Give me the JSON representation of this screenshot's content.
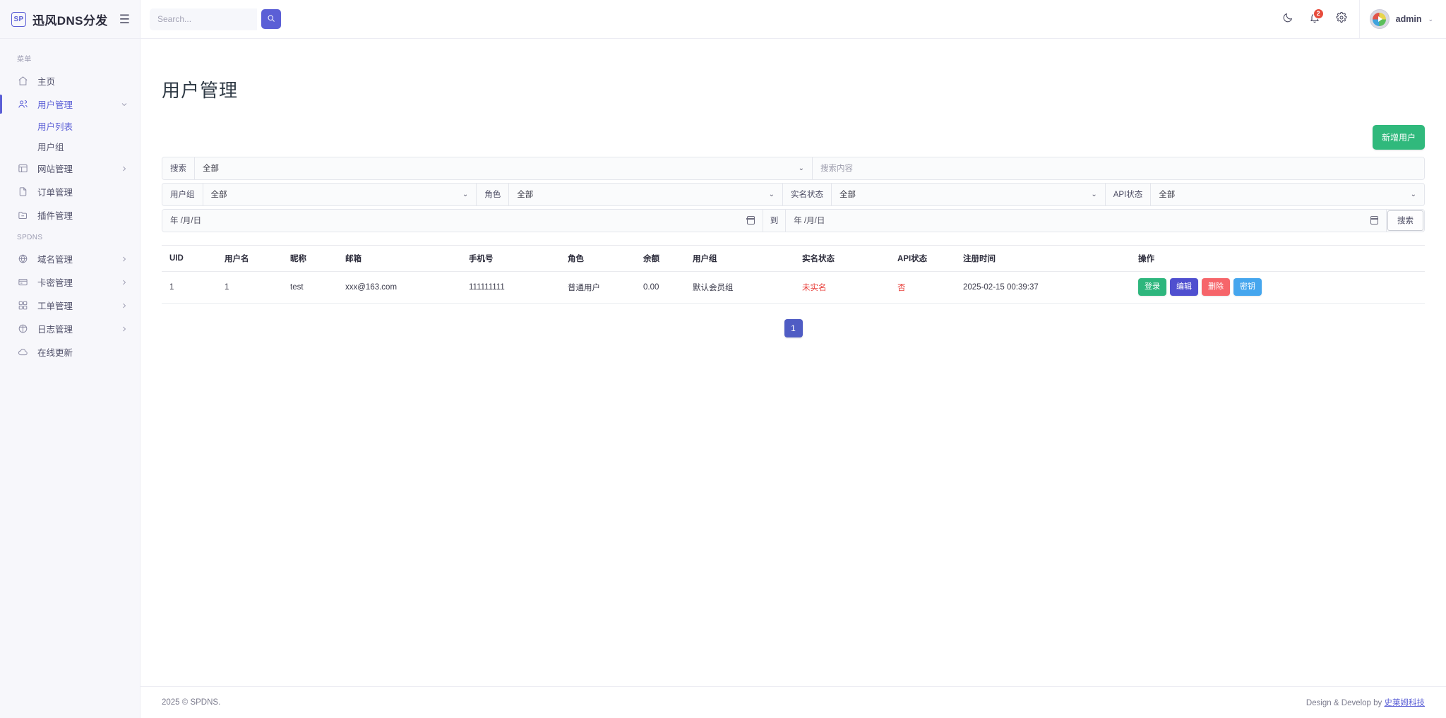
{
  "brand": {
    "badge": "SP",
    "name": "迅风DNS分发",
    "menu_icon": "hamburger-icon"
  },
  "topbar": {
    "search_placeholder": "Search...",
    "search_value": "",
    "search_button_icon": "search-icon",
    "dark_mode_icon": "moon-icon",
    "notifications_icon": "bell-icon",
    "notifications_count": "2",
    "settings_icon": "gear-icon",
    "user_name": "admin",
    "user_caret": "⌄"
  },
  "sidebar": {
    "section_menu": "菜单",
    "section_spdns": "SPDNS",
    "menu_items": [
      {
        "label": "主页",
        "icon": "home-icon",
        "active": false,
        "expandable": false
      },
      {
        "label": "用户管理",
        "icon": "users-icon",
        "active": true,
        "expandable": true
      },
      {
        "label": "网站管理",
        "icon": "layout-icon",
        "active": false,
        "expandable": true
      },
      {
        "label": "订单管理",
        "icon": "file-icon",
        "active": false,
        "expandable": false
      },
      {
        "label": "插件管理",
        "icon": "folder-icon",
        "active": false,
        "expandable": false
      }
    ],
    "sub_items": [
      {
        "label": "用户列表",
        "active": true
      },
      {
        "label": "用户组",
        "active": false
      }
    ],
    "spdns_items": [
      {
        "label": "域名管理",
        "icon": "globe-icon",
        "expandable": true
      },
      {
        "label": "卡密管理",
        "icon": "card-icon",
        "expandable": true
      },
      {
        "label": "工单管理",
        "icon": "grid-icon",
        "expandable": true
      },
      {
        "label": "日志管理",
        "icon": "log-icon",
        "expandable": true
      },
      {
        "label": "在线更新",
        "icon": "cloud-icon",
        "expandable": false
      }
    ]
  },
  "page": {
    "title": "用户管理",
    "add_user_button": "新增用户"
  },
  "filters": {
    "row1": {
      "label": "搜索",
      "select_value": "全部",
      "chevron": "⌄",
      "keyword_placeholder": "搜索内容"
    },
    "row2": [
      {
        "label": "用户组",
        "value": "全部",
        "chevron": "⌄"
      },
      {
        "label": "角色",
        "value": "全部",
        "chevron": "⌄"
      },
      {
        "label": "实名状态",
        "value": "全部",
        "chevron": "⌄"
      },
      {
        "label": "API状态",
        "value": "全部",
        "chevron": "⌄"
      }
    ],
    "row3": {
      "date_start": "年 /月/日",
      "separator": "到",
      "date_end": "年 /月/日",
      "search_button": "搜索"
    }
  },
  "table": {
    "columns": [
      "UID",
      "用户名",
      "昵称",
      "邮箱",
      "手机号",
      "角色",
      "余额",
      "用户组",
      "实名状态",
      "API状态",
      "注册时间",
      "操作"
    ],
    "rows": [
      {
        "uid": "1",
        "username": "1",
        "nickname": "test",
        "email": "xxx@163.com",
        "phone": "111111111",
        "role": "普通用户",
        "balance": "0.00",
        "group": "默认会员组",
        "realname_status": "未实名",
        "api_status": "否",
        "register_time": "2025-02-15 00:39:37",
        "actions": [
          {
            "label": "登录",
            "style": "login"
          },
          {
            "label": "编辑",
            "style": "edit"
          },
          {
            "label": "删除",
            "style": "del"
          },
          {
            "label": "密钥",
            "style": "key"
          }
        ]
      }
    ]
  },
  "pagination": {
    "current": "1"
  },
  "footer": {
    "copyright": "2025 © SPDNS.",
    "credit_prefix": "Design & Develop by ",
    "credit_link": "史莱姆科技"
  },
  "colors": {
    "accent": "#5b5fd6",
    "success": "#2eb67d",
    "danger": "#f6656a",
    "info": "#45a6ee",
    "edit": "#4f4fcf",
    "alert_text": "#e8413c"
  }
}
